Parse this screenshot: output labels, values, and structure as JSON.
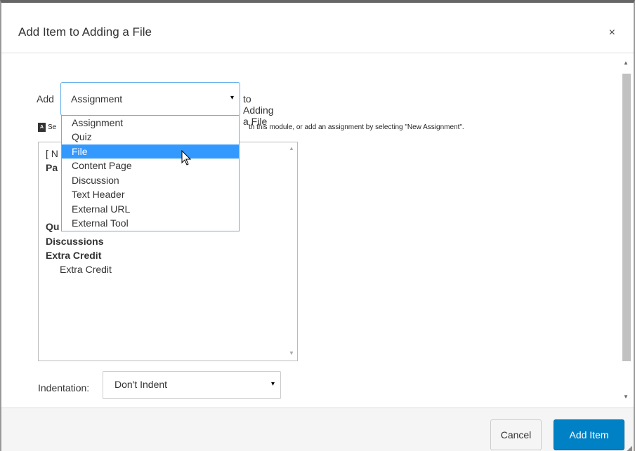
{
  "dialog": {
    "title": "Add Item to Adding a File",
    "close_glyph": "×"
  },
  "add_row": {
    "prefix": "Add",
    "selected_type": "Assignment",
    "suffix": "to Adding a File"
  },
  "hint": {
    "icon_text": "A",
    "text_start": "Se",
    "text_end": "th this module, or add an assignment by selecting \"New Assignment\"."
  },
  "type_options": [
    "Assignment",
    "Quiz",
    "File",
    "Content Page",
    "Discussion",
    "Text Header",
    "External URL",
    "External Tool"
  ],
  "highlighted_option": "File",
  "list": {
    "partial_new": "[ N",
    "partial_group_1": "Pa",
    "partial_group_2": "Qu",
    "discussions": "Discussions",
    "extra_credit_group": "Extra Credit",
    "extra_credit_item": "Extra Credit"
  },
  "indentation": {
    "label": "Indentation:",
    "value": "Don't Indent"
  },
  "footer": {
    "cancel_label": "Cancel",
    "add_item_label": "Add Item"
  },
  "icons": {
    "caret": "▾",
    "scroll_up": "▲",
    "scroll_down": "▼",
    "resize": "◢"
  },
  "colors": {
    "primary": "#0081c6",
    "highlight": "#3399ff",
    "focus_border": "#66afe9"
  }
}
